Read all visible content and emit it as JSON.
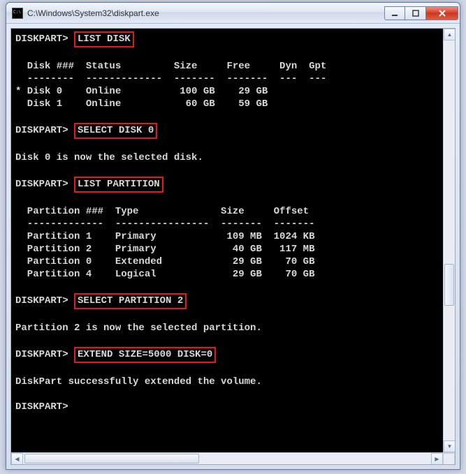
{
  "window": {
    "title": "C:\\Windows\\System32\\diskpart.exe"
  },
  "prompt": "DISKPART>",
  "commands": {
    "list_disk": "LIST DISK",
    "select_disk": "SELECT DISK 0",
    "list_partition": "LIST PARTITION",
    "select_partition": "SELECT PARTITION 2",
    "extend": "EXTEND SIZE=5000 DISK=0"
  },
  "disk_table": {
    "header": "  Disk ###  Status         Size     Free     Dyn  Gpt",
    "separator": "  --------  -------------  -------  -------  ---  ---",
    "rows": [
      "* Disk 0    Online          100 GB    29 GB",
      "  Disk 1    Online           60 GB    59 GB"
    ]
  },
  "messages": {
    "disk_selected": "Disk 0 is now the selected disk.",
    "partition_selected": "Partition 2 is now the selected partition.",
    "extend_success": "DiskPart successfully extended the volume."
  },
  "partition_table": {
    "header": "  Partition ###  Type              Size     Offset",
    "separator": "  -------------  ----------------  -------  -------",
    "rows": [
      "  Partition 1    Primary            109 MB  1024 KB",
      "  Partition 2    Primary             40 GB   117 MB",
      "  Partition 0    Extended            29 GB    70 GB",
      "  Partition 4    Logical             29 GB    70 GB"
    ]
  }
}
